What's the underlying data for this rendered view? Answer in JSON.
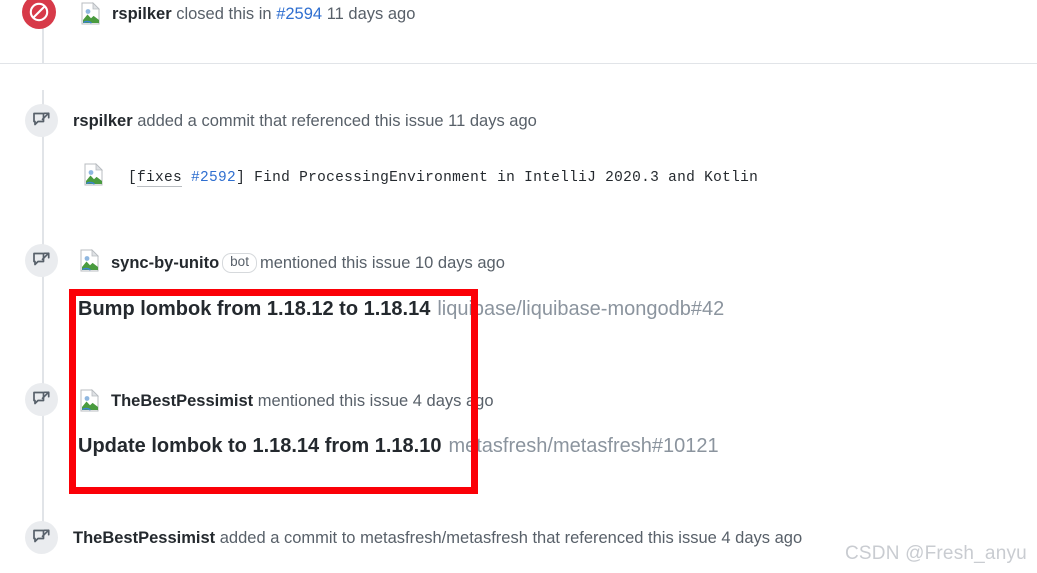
{
  "timeline": {
    "closed_event": {
      "icon": "issue-closed-icon",
      "avatar": "broken-image-avatar",
      "actor": "rspilker",
      "text_before": "closed this in",
      "issue_ref": "#2594",
      "timestamp": "11 days ago"
    },
    "events": [
      {
        "icon": "cross-reference-icon",
        "actor": "rspilker",
        "text": "added a commit that referenced this issue",
        "timestamp": "11 days ago",
        "commit": {
          "avatar": "broken-image-avatar",
          "prefix": "[",
          "fixes_label": "fixes",
          "issue_ref": "#2592",
          "suffix": "]",
          "message": "Find ProcessingEnvironment in IntelliJ 2020.3 and Kotlin"
        }
      },
      {
        "icon": "cross-reference-icon",
        "avatar": "broken-image-avatar",
        "actor": "sync-by-unito",
        "badge": "bot",
        "text": "mentioned this issue",
        "timestamp": "10 days ago",
        "reference": {
          "title": "Bump lombok from 1.18.12 to 1.18.14",
          "repo_ref": "liquibase/liquibase-mongodb#42"
        }
      },
      {
        "icon": "cross-reference-icon",
        "avatar": "broken-image-avatar",
        "actor": "TheBestPessimist",
        "text": "mentioned this issue",
        "timestamp": "4 days ago",
        "reference": {
          "title": "Update lombok to 1.18.14 from 1.18.10",
          "repo_ref": "metasfresh/metasfresh#10121"
        }
      },
      {
        "icon": "cross-reference-icon",
        "actor": "TheBestPessimist",
        "text": "added a commit to metasfresh/metasfresh that referenced this issue",
        "timestamp": "4 days ago"
      }
    ]
  },
  "annotation": {
    "name": "red-highlight-box",
    "color": "#fb0007"
  },
  "watermark": {
    "text": "CSDN @Fresh_anyu"
  },
  "colors": {
    "closed_badge": "#d73a49",
    "link": "#2f6fd0",
    "muted_text": "#586069",
    "repo_ref": "#8b949e",
    "rail": "#e1e4e8"
  }
}
